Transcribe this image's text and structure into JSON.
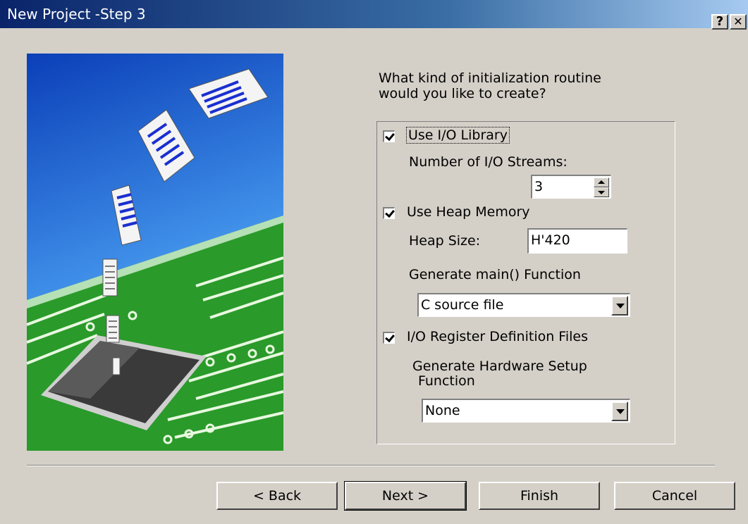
{
  "window": {
    "title": "New Project -Step 3",
    "help_label": "?",
    "close_label": "✕"
  },
  "question": {
    "line1": "What kind of initialization routine",
    "line2": "would you like to create?"
  },
  "io_library": {
    "label": "Use I/O Library",
    "checked": true,
    "streams_label": "Number of I/O Streams:",
    "streams_value": "3"
  },
  "heap": {
    "label": "Use Heap Memory",
    "checked": true,
    "size_label": "Heap Size:",
    "size_value": "H'420"
  },
  "main_func": {
    "label": "Generate main() Function",
    "selected": "C source file"
  },
  "io_register": {
    "label": "I/O Register Definition Files",
    "checked": true
  },
  "hw_setup": {
    "label_line1": "Generate Hardware Setup",
    "label_line2": "Function",
    "selected": "None"
  },
  "buttons": {
    "back": "< Back",
    "next": "Next >",
    "finish": "Finish",
    "cancel": "Cancel"
  }
}
